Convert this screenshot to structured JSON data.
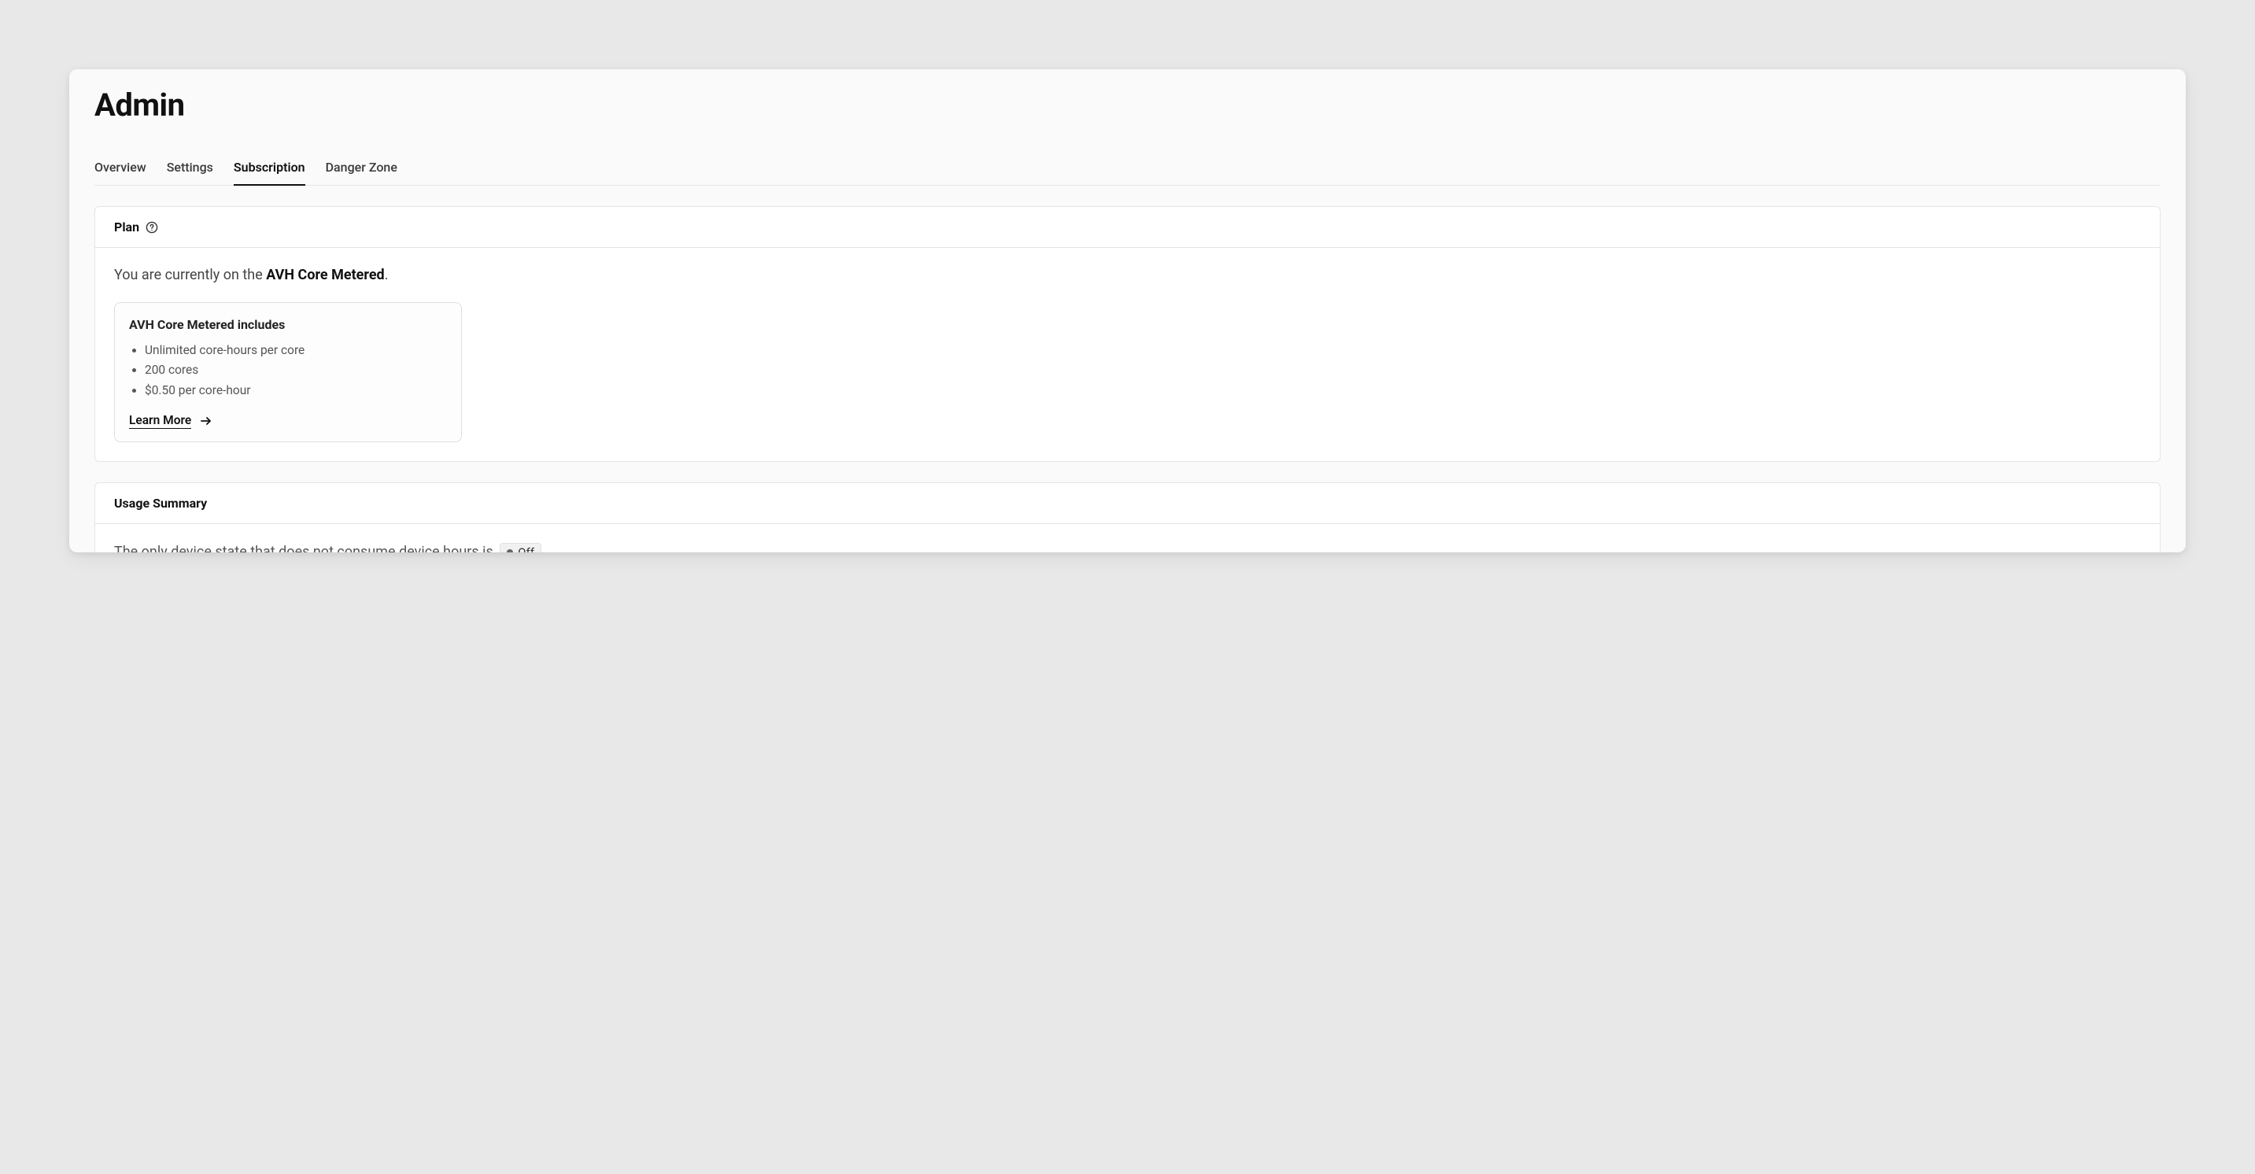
{
  "page": {
    "title": "Admin"
  },
  "tabs": [
    {
      "label": "Overview",
      "active": false
    },
    {
      "label": "Settings",
      "active": false
    },
    {
      "label": "Subscription",
      "active": true
    },
    {
      "label": "Danger Zone",
      "active": false
    }
  ],
  "plan_panel": {
    "header": "Plan",
    "current_prefix": "You are currently on the ",
    "current_plan_name": "AVH Core Metered",
    "current_suffix": ".",
    "includes_title": "AVH Core Metered includes",
    "includes": [
      "Unlimited core-hours per core",
      "200 cores",
      "$0.50 per core-hour"
    ],
    "learn_more": "Learn More"
  },
  "usage_panel": {
    "header": "Usage Summary",
    "line_prefix": "The only device state that does not consume device hours is",
    "off_chip": "Off"
  }
}
